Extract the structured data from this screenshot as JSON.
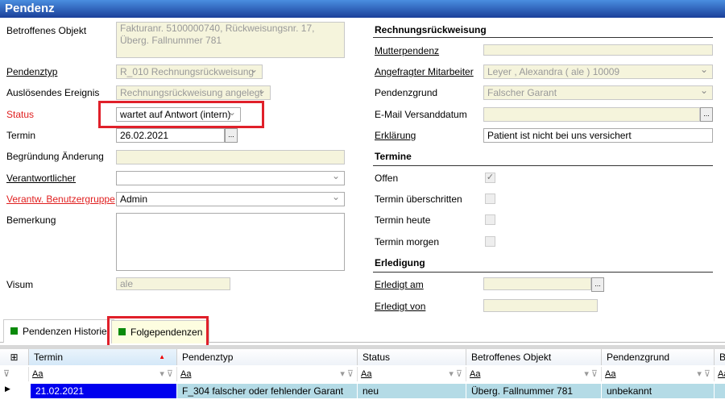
{
  "title": "Pendenz",
  "left": {
    "betroffenes_objekt": {
      "label": "Betroffenes Objekt",
      "value": "Fakturanr. 5100000740, Rückweisungsnr. 17, Überg. Fallnummer 781"
    },
    "pendenztyp": {
      "label": "Pendenztyp",
      "value": "R_010 Rechnungsrückweisung"
    },
    "ausloesendes": {
      "label": "Auslösendes Ereignis",
      "value": "Rechnungsrückweisung angelegt"
    },
    "status": {
      "label": "Status",
      "value": "wartet auf Antwort (intern)"
    },
    "termin": {
      "label": "Termin",
      "value": "26.02.2021",
      "button": "..."
    },
    "begruendung": {
      "label": "Begründung Änderung",
      "value": ""
    },
    "verantwortlicher": {
      "label": "Verantwortlicher",
      "value": ""
    },
    "gruppe": {
      "label": "Verantw. Benutzergruppe",
      "value": "Admin"
    },
    "bemerkung": {
      "label": "Bemerkung",
      "value": ""
    },
    "visum": {
      "label": "Visum",
      "value": "ale"
    }
  },
  "right": {
    "section1": "Rechnungsrückweisung",
    "mutterpendenz": {
      "label": "Mutterpendenz",
      "value": ""
    },
    "mitarbeiter": {
      "label": "Angefragter Mitarbeiter",
      "value": "Leyer , Alexandra  ( ale ) 10009"
    },
    "pendenzgrund": {
      "label": "Pendenzgrund",
      "value": "Falscher Garant"
    },
    "email": {
      "label": "E-Mail Versanddatum",
      "value": "",
      "button": "..."
    },
    "erklaerung": {
      "label": "Erklärung",
      "value": "Patient ist nicht bei uns versichert"
    },
    "section2": "Termine",
    "offen": {
      "label": "Offen",
      "checked": true
    },
    "ueberschritten": {
      "label": "Termin überschritten",
      "checked": false
    },
    "heute": {
      "label": "Termin heute",
      "checked": false
    },
    "morgen": {
      "label": "Termin morgen",
      "checked": false
    },
    "section3": "Erledigung",
    "erledigt_am": {
      "label": "Erledigt am",
      "value": "",
      "button": "..."
    },
    "erledigt_von": {
      "label": "Erledigt von",
      "value": ""
    }
  },
  "tabs": [
    {
      "label": "Pendenzen Historie"
    },
    {
      "label": "Folgependenzen",
      "active": true
    }
  ],
  "grid": {
    "columns": [
      "Termin",
      "Pendenztyp",
      "Status",
      "Betroffenes Objekt",
      "Pendenzgrund",
      "B"
    ],
    "filter": "Aa",
    "rows": [
      [
        "21.02.2021",
        "F_304 falscher oder fehlender Garant",
        "neu",
        "Überg. Fallnummer 781",
        "unbekannt",
        ""
      ]
    ]
  }
}
